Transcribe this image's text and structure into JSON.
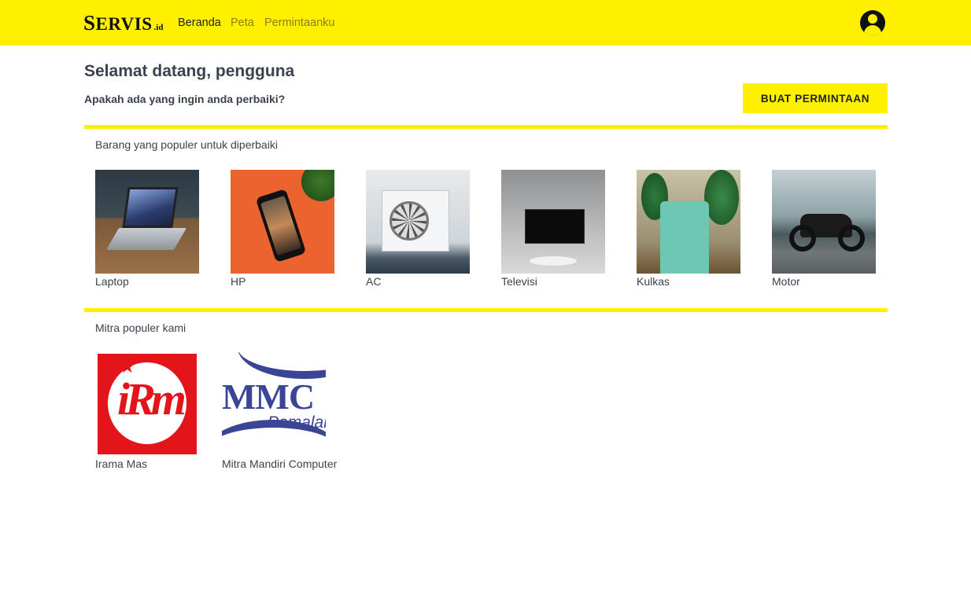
{
  "brand": {
    "logo_main": "ERVIS",
    "logo_initial": "S",
    "logo_sub": ".id",
    "accent_color": "#fff000"
  },
  "nav": {
    "items": [
      {
        "label": "Beranda"
      },
      {
        "label": "Peta"
      },
      {
        "label": "Permintaanku"
      }
    ],
    "active": "Beranda",
    "profile_icon": "user-circle-icon"
  },
  "header": {
    "welcome": "Selamat datang, pengguna",
    "question": "Apakah ada yang ingin anda perbaiki?",
    "cta_label": "BUAT PERMINTAAN"
  },
  "popular_items": {
    "title": "Barang yang populer untuk diperbaiki",
    "items": [
      {
        "label": "Laptop"
      },
      {
        "label": "HP"
      },
      {
        "label": "AC"
      },
      {
        "label": "Televisi"
      },
      {
        "label": "Kulkas"
      },
      {
        "label": "Motor"
      }
    ]
  },
  "partners": {
    "title": "Mitra populer kami",
    "items": [
      {
        "label": "Irama Mas",
        "logo_text": "iRm"
      },
      {
        "label": "Mitra Mandiri Computer",
        "logo_text": "MMC",
        "logo_subtext": "Pemalang"
      }
    ]
  }
}
